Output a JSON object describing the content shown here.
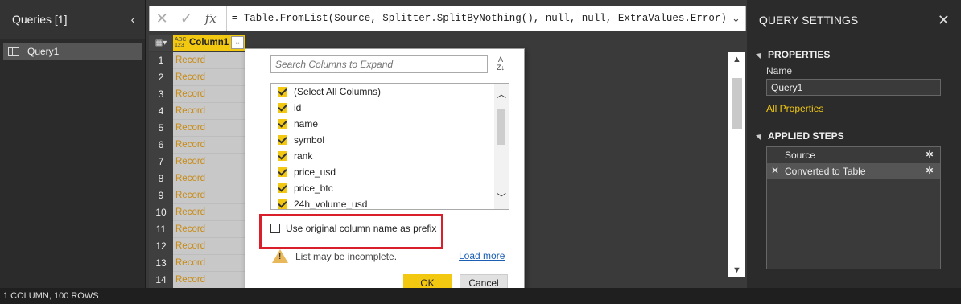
{
  "queries": {
    "title": "Queries [1]",
    "collapse_icon": "chevron-left",
    "items": [
      {
        "label": "Query1"
      }
    ]
  },
  "formula": {
    "cancel_icon": "✕",
    "commit_icon": "✓",
    "fx": "fx",
    "text": "= Table.FromList(Source, Splitter.SplitByNothing(), null, null, ExtraValues.Error)",
    "expand_icon": "chevron-down"
  },
  "grid": {
    "column_type": "ABC 123",
    "column_name": "Column1",
    "rows": [
      {
        "num": "1",
        "value": "Record"
      },
      {
        "num": "2",
        "value": "Record"
      },
      {
        "num": "3",
        "value": "Record"
      },
      {
        "num": "4",
        "value": "Record"
      },
      {
        "num": "5",
        "value": "Record"
      },
      {
        "num": "6",
        "value": "Record"
      },
      {
        "num": "7",
        "value": "Record"
      },
      {
        "num": "8",
        "value": "Record"
      },
      {
        "num": "9",
        "value": "Record"
      },
      {
        "num": "10",
        "value": "Record"
      },
      {
        "num": "11",
        "value": "Record"
      },
      {
        "num": "12",
        "value": "Record"
      },
      {
        "num": "13",
        "value": "Record"
      },
      {
        "num": "14",
        "value": "Record"
      }
    ]
  },
  "expand_dialog": {
    "search_placeholder": "Search Columns to Expand",
    "sort_icon": "A→Z sort",
    "columns": [
      {
        "label": "(Select All Columns)",
        "checked": true
      },
      {
        "label": "id",
        "checked": true
      },
      {
        "label": "name",
        "checked": true
      },
      {
        "label": "symbol",
        "checked": true
      },
      {
        "label": "rank",
        "checked": true
      },
      {
        "label": "price_usd",
        "checked": true
      },
      {
        "label": "price_btc",
        "checked": true
      },
      {
        "label": "24h_volume_usd",
        "checked": true
      }
    ],
    "prefix_label": "Use original column name as prefix",
    "prefix_checked": false,
    "warning": "List may be incomplete.",
    "load_more": "Load more",
    "ok": "OK",
    "cancel": "Cancel",
    "highlight_color": "#d9202a"
  },
  "settings": {
    "title": "QUERY SETTINGS",
    "close_icon": "✕",
    "properties_title": "PROPERTIES",
    "name_label": "Name",
    "name_value": "Query1",
    "all_properties": "All Properties",
    "steps_title": "APPLIED STEPS",
    "steps": [
      {
        "label": "Source",
        "selected": false
      },
      {
        "label": "Converted to Table",
        "selected": true
      }
    ]
  },
  "status": {
    "text": "1 COLUMN, 100 ROWS"
  },
  "colors": {
    "accent": "#f2c811",
    "record_text": "#c98b15"
  }
}
